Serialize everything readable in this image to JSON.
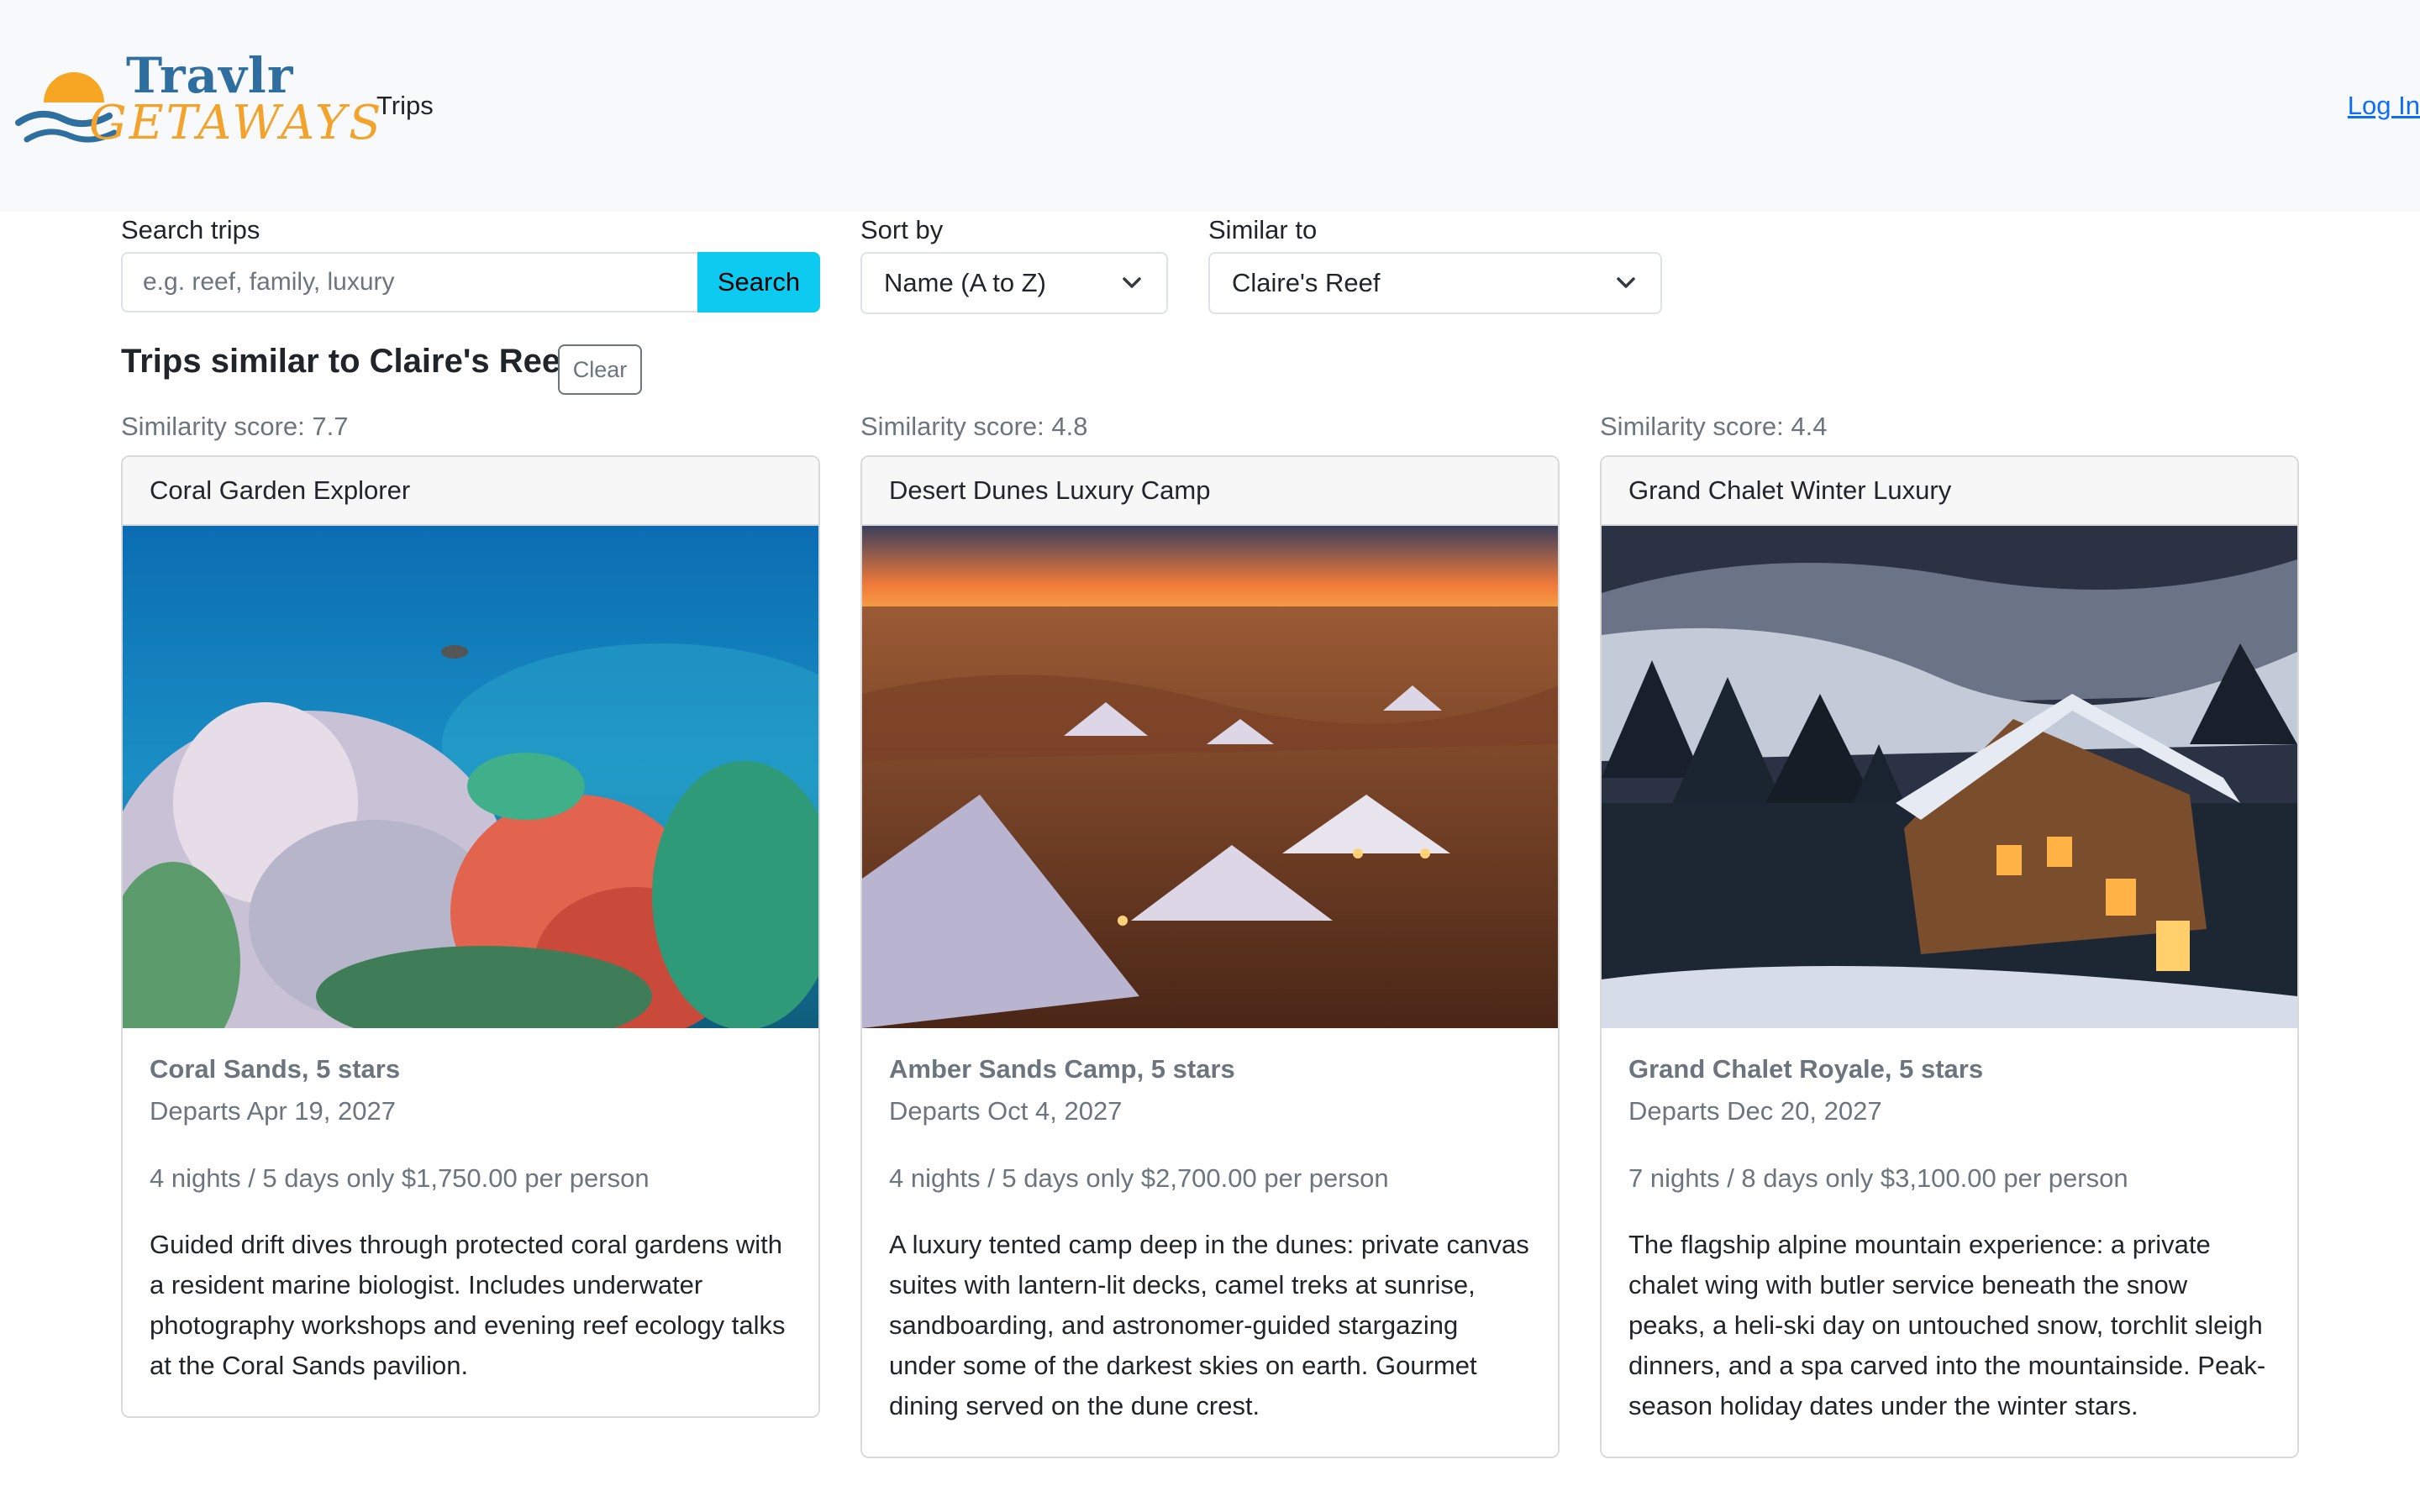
{
  "nav": {
    "brand_line1": "Travlr",
    "brand_line2": "GETAWAYS",
    "trips_link": "Trips",
    "login_link": "Log In"
  },
  "filters": {
    "search_label": "Search trips",
    "search_placeholder": "e.g. reef, family, luxury",
    "search_value": "",
    "search_button": "Search",
    "sort_label": "Sort by",
    "sort_value": "Name (A to Z)",
    "similar_label": "Similar to",
    "similar_value": "Claire's Reef"
  },
  "results": {
    "heading": "Trips similar to Claire's Reef",
    "clear_button": "Clear"
  },
  "cards": [
    {
      "score": "Similarity score: 7.7",
      "title": "Coral Garden Explorer",
      "image": "coral-reef-photo",
      "hotel": "Coral Sands, 5 stars",
      "departs": "Departs Apr 19, 2027",
      "price": "4 nights / 5 days only $1,750.00 per person",
      "description": "Guided drift dives through protected coral gardens with a resident marine biologist. Includes underwater photography workshops and evening reef ecology talks at the Coral Sands pavilion."
    },
    {
      "score": "Similarity score: 4.8",
      "title": "Desert Dunes Luxury Camp",
      "image": "desert-tents-photo",
      "hotel": "Amber Sands Camp, 5 stars",
      "departs": "Departs Oct 4, 2027",
      "price": "4 nights / 5 days only $2,700.00 per person",
      "description": "A luxury tented camp deep in the dunes: private canvas suites with lantern-lit decks, camel treks at sunrise, sandboarding, and astronomer-guided stargazing under some of the darkest skies on earth. Gourmet dining served on the dune crest."
    },
    {
      "score": "Similarity score: 4.4",
      "title": "Grand Chalet Winter Luxury",
      "image": "alpine-chalet-photo",
      "hotel": "Grand Chalet Royale, 5 stars",
      "departs": "Departs Dec 20, 2027",
      "price": "7 nights / 8 days only $3,100.00 per person",
      "description": "The flagship alpine mountain experience: a private chalet wing with butler service beneath the snow peaks, a heli-ski day on untouched snow, torchlit sleigh dinners, and a spa carved into the mountainside. Peak-season holiday dates under the winter stars."
    }
  ]
}
